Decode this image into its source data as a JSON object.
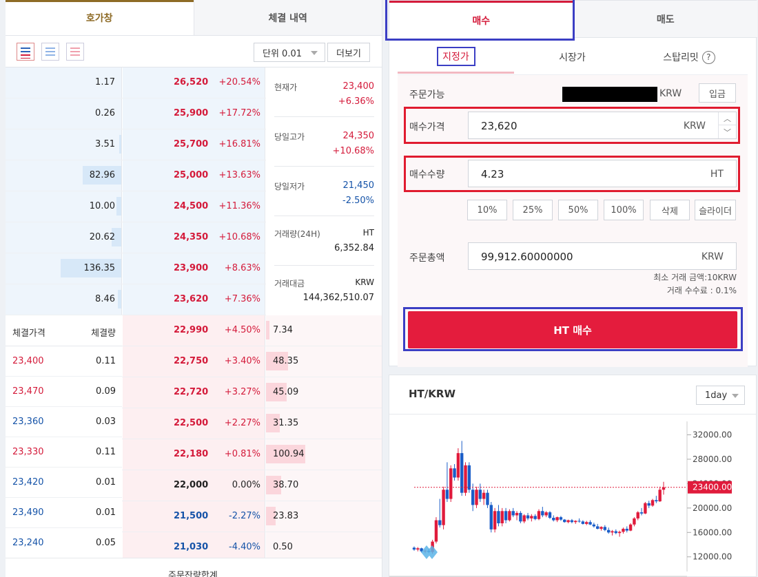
{
  "left_tabs": {
    "orderbook": "호가창",
    "trades": "체결 내역"
  },
  "toolbar": {
    "unit": "단위 0.01",
    "more": "더보기"
  },
  "asks": [
    {
      "qty": "1.17",
      "price": "26,520",
      "pct": "+20.54%",
      "depth": 0.0
    },
    {
      "qty": "0.26",
      "price": "25,900",
      "pct": "+17.72%",
      "depth": 0.0
    },
    {
      "qty": "3.51",
      "price": "25,700",
      "pct": "+16.81%",
      "depth": 0.02
    },
    {
      "qty": "82.96",
      "price": "25,000",
      "pct": "+13.63%",
      "depth": 0.33
    },
    {
      "qty": "10.00",
      "price": "24,500",
      "pct": "+11.36%",
      "depth": 0.04
    },
    {
      "qty": "20.62",
      "price": "24,350",
      "pct": "+10.68%",
      "depth": 0.08
    },
    {
      "qty": "136.35",
      "price": "23,900",
      "pct": "+8.63%",
      "depth": 0.52
    },
    {
      "qty": "8.46",
      "price": "23,620",
      "pct": "+7.36%",
      "depth": 0.03
    }
  ],
  "bids": [
    {
      "price": "22,990",
      "pct": "+4.50%",
      "qty": "7.34",
      "depth": 0.03,
      "color": "r"
    },
    {
      "price": "22,750",
      "pct": "+3.40%",
      "qty": "48.35",
      "depth": 0.19,
      "color": "r"
    },
    {
      "price": "22,720",
      "pct": "+3.27%",
      "qty": "45.09",
      "depth": 0.18,
      "color": "r"
    },
    {
      "price": "22,500",
      "pct": "+2.27%",
      "qty": "31.35",
      "depth": 0.12,
      "color": "r"
    },
    {
      "price": "22,180",
      "pct": "+0.81%",
      "qty": "100.94",
      "depth": 0.34,
      "color": "r"
    },
    {
      "price": "22,000",
      "pct": "0.00%",
      "qty": "38.70",
      "depth": 0.13,
      "color": "k"
    },
    {
      "price": "21,500",
      "pct": "-2.27%",
      "qty": "23.83",
      "depth": 0.08,
      "color": "b"
    },
    {
      "price": "21,030",
      "pct": "-4.40%",
      "qty": "0.50",
      "depth": 0.0,
      "color": "b"
    }
  ],
  "info": {
    "current_label": "현재가",
    "current": "23,400",
    "current_pct": "+6.36%",
    "high_label": "당일고가",
    "high": "24,350",
    "high_pct": "+10.68%",
    "low_label": "당일저가",
    "low": "21,450",
    "low_pct": "-2.50%",
    "volume_label": "거래량(24H)",
    "volume_unit": "HT",
    "volume": "6,352.84",
    "amount_label": "거래대금",
    "amount_unit": "KRW",
    "amount": "144,362,510.07"
  },
  "trades_header": {
    "price": "체결가격",
    "qty": "체결량"
  },
  "trades": [
    {
      "price": "23,400",
      "qty": "0.11",
      "color": "r"
    },
    {
      "price": "23,470",
      "qty": "0.09",
      "color": "r"
    },
    {
      "price": "23,360",
      "qty": "0.03",
      "color": "b"
    },
    {
      "price": "23,330",
      "qty": "0.11",
      "color": "r"
    },
    {
      "price": "23,420",
      "qty": "0.01",
      "color": "b"
    },
    {
      "price": "23,490",
      "qty": "0.01",
      "color": "b"
    },
    {
      "price": "23,240",
      "qty": "0.05",
      "color": "b"
    }
  ],
  "footer": "주문잔량합계",
  "order_tabs": {
    "buy": "매수",
    "sell": "매도"
  },
  "order_types": {
    "limit": "지정가",
    "market": "시장가",
    "stop": "스탑리밋",
    "help": "?"
  },
  "form": {
    "available_label": "주문가능",
    "available_unit": "KRW",
    "deposit": "입금",
    "price_label": "매수가격",
    "price_value": "23,620",
    "price_unit": "KRW",
    "qty_label": "매수수량",
    "qty_value": "4.23",
    "qty_unit": "HT",
    "pct_buttons": [
      "10%",
      "25%",
      "50%",
      "100%",
      "삭제",
      "슬라이더"
    ],
    "total_label": "주문총액",
    "total_value": "99,912.60000000",
    "total_unit": "KRW",
    "min_note": "최소 거래 금액:10KRW",
    "fee_note": "거래 수수료 : 0.1%",
    "submit": "HT 매수"
  },
  "chart_data": {
    "type": "candlestick",
    "title": "HT/KRW",
    "interval": "1day",
    "y_ticks": [
      "32000.00",
      "28000.00",
      "24000.00",
      "20000.00",
      "16000.00",
      "12000.00"
    ],
    "last_price_label": "23400.00",
    "last_price": 23400,
    "ylim": [
      9600,
      34200
    ],
    "candles": [
      [
        13500,
        13700,
        13000,
        13200
      ],
      [
        13200,
        13600,
        12900,
        13400
      ],
      [
        13400,
        13500,
        12700,
        12900
      ],
      [
        12900,
        13200,
        12600,
        13000
      ],
      [
        13000,
        13300,
        12600,
        12800
      ],
      [
        12800,
        14800,
        12500,
        14500
      ],
      [
        14500,
        18500,
        14200,
        18000
      ],
      [
        18000,
        21500,
        16800,
        17200
      ],
      [
        17200,
        23500,
        16500,
        23000
      ],
      [
        23000,
        27500,
        21000,
        21500
      ],
      [
        21500,
        27000,
        21000,
        26500
      ],
      [
        26500,
        27200,
        24500,
        25000
      ],
      [
        25000,
        29800,
        24500,
        29000
      ],
      [
        29000,
        31000,
        22000,
        22500
      ],
      [
        22500,
        27500,
        22000,
        27000
      ],
      [
        27000,
        27500,
        22500,
        23000
      ],
      [
        23000,
        24000,
        19500,
        20500
      ],
      [
        20500,
        23500,
        20000,
        23000
      ],
      [
        23000,
        24000,
        21000,
        21500
      ],
      [
        21500,
        23000,
        20500,
        22500
      ],
      [
        22500,
        23000,
        20000,
        20500
      ],
      [
        20500,
        21000,
        16000,
        16500
      ],
      [
        16500,
        20000,
        16000,
        19500
      ],
      [
        19500,
        20500,
        17000,
        17500
      ],
      [
        17500,
        20000,
        17000,
        19500
      ],
      [
        19500,
        20000,
        17500,
        18000
      ],
      [
        18000,
        19800,
        17800,
        19500
      ],
      [
        19500,
        20000,
        18500,
        18800
      ],
      [
        18800,
        19500,
        18000,
        19200
      ],
      [
        19200,
        19500,
        17500,
        17800
      ],
      [
        17800,
        19000,
        17500,
        18800
      ],
      [
        18800,
        19200,
        18000,
        18300
      ],
      [
        18300,
        19000,
        17800,
        18700
      ],
      [
        18700,
        19000,
        18000,
        18200
      ],
      [
        18200,
        19800,
        18000,
        19500
      ],
      [
        19500,
        20200,
        18500,
        18800
      ],
      [
        18800,
        19500,
        18500,
        19300
      ],
      [
        19300,
        19500,
        18200,
        18400
      ],
      [
        18400,
        18800,
        17800,
        18000
      ],
      [
        18000,
        18600,
        17700,
        18500
      ],
      [
        18500,
        18700,
        17900,
        18100
      ],
      [
        18100,
        18200,
        17600,
        17700
      ],
      [
        17700,
        18100,
        17500,
        18000
      ],
      [
        18000,
        18200,
        17500,
        17700
      ],
      [
        17700,
        18000,
        17400,
        17900
      ],
      [
        17900,
        18300,
        17600,
        17800
      ],
      [
        17800,
        18000,
        17300,
        17400
      ],
      [
        17400,
        17900,
        17200,
        17700
      ],
      [
        17700,
        18000,
        17200,
        17300
      ],
      [
        17300,
        17600,
        16800,
        17000
      ],
      [
        17000,
        17400,
        16500,
        16600
      ],
      [
        16600,
        17000,
        16300,
        16900
      ],
      [
        16900,
        17200,
        16200,
        16400
      ],
      [
        16400,
        16800,
        15800,
        16000
      ],
      [
        16000,
        16400,
        15500,
        16200
      ],
      [
        16200,
        16500,
        15700,
        15900
      ],
      [
        15900,
        16300,
        15300,
        16100
      ],
      [
        16100,
        16800,
        15800,
        16600
      ],
      [
        16600,
        17000,
        16000,
        16300
      ],
      [
        16300,
        17500,
        16200,
        17300
      ],
      [
        17300,
        18500,
        17000,
        18300
      ],
      [
        18300,
        19500,
        18000,
        19300
      ],
      [
        19300,
        20000,
        18800,
        19100
      ],
      [
        19100,
        21000,
        19000,
        20800
      ],
      [
        20800,
        21200,
        20000,
        20400
      ],
      [
        20400,
        21500,
        20200,
        21300
      ],
      [
        21300,
        22000,
        20800,
        21100
      ],
      [
        21100,
        23500,
        21000,
        23000
      ],
      [
        23000,
        24300,
        22200,
        23400
      ]
    ]
  }
}
